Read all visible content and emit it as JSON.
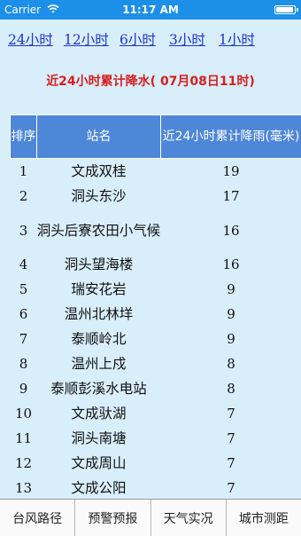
{
  "status": {
    "carrier": "Carrier",
    "time": "11:17 AM",
    "battery_level": 0.95
  },
  "range_links": [
    "24小时",
    "12小时",
    "6小时",
    "3小时",
    "1小时"
  ],
  "title": "近24小时累计降水( 07月08日11时)",
  "table": {
    "headers": [
      "排序",
      "站名",
      "近24小时累计降雨(毫米)"
    ],
    "rows": [
      {
        "rank": "1",
        "station": "文成双桂",
        "value": "19"
      },
      {
        "rank": "2",
        "station": "洞头东沙",
        "value": "17"
      },
      {
        "rank": "3",
        "station": "洞头后寮农田小气候",
        "value": "16"
      },
      {
        "rank": "4",
        "station": "洞头望海楼",
        "value": "16"
      },
      {
        "rank": "5",
        "station": "瑞安花岩",
        "value": "9"
      },
      {
        "rank": "6",
        "station": "温州北林垟",
        "value": "9"
      },
      {
        "rank": "7",
        "station": "泰顺岭北",
        "value": "9"
      },
      {
        "rank": "8",
        "station": "温州上戍",
        "value": "8"
      },
      {
        "rank": "9",
        "station": "泰顺彭溪水电站",
        "value": "8"
      },
      {
        "rank": "10",
        "station": "文成驮湖",
        "value": "7"
      },
      {
        "rank": "11",
        "station": "洞头南塘",
        "value": "7"
      },
      {
        "rank": "12",
        "station": "文成周山",
        "value": "7"
      },
      {
        "rank": "13",
        "station": "文成公阳",
        "value": "7"
      }
    ]
  },
  "tabs": [
    "台风路径",
    "预警预报",
    "天气实况",
    "城市测距"
  ]
}
